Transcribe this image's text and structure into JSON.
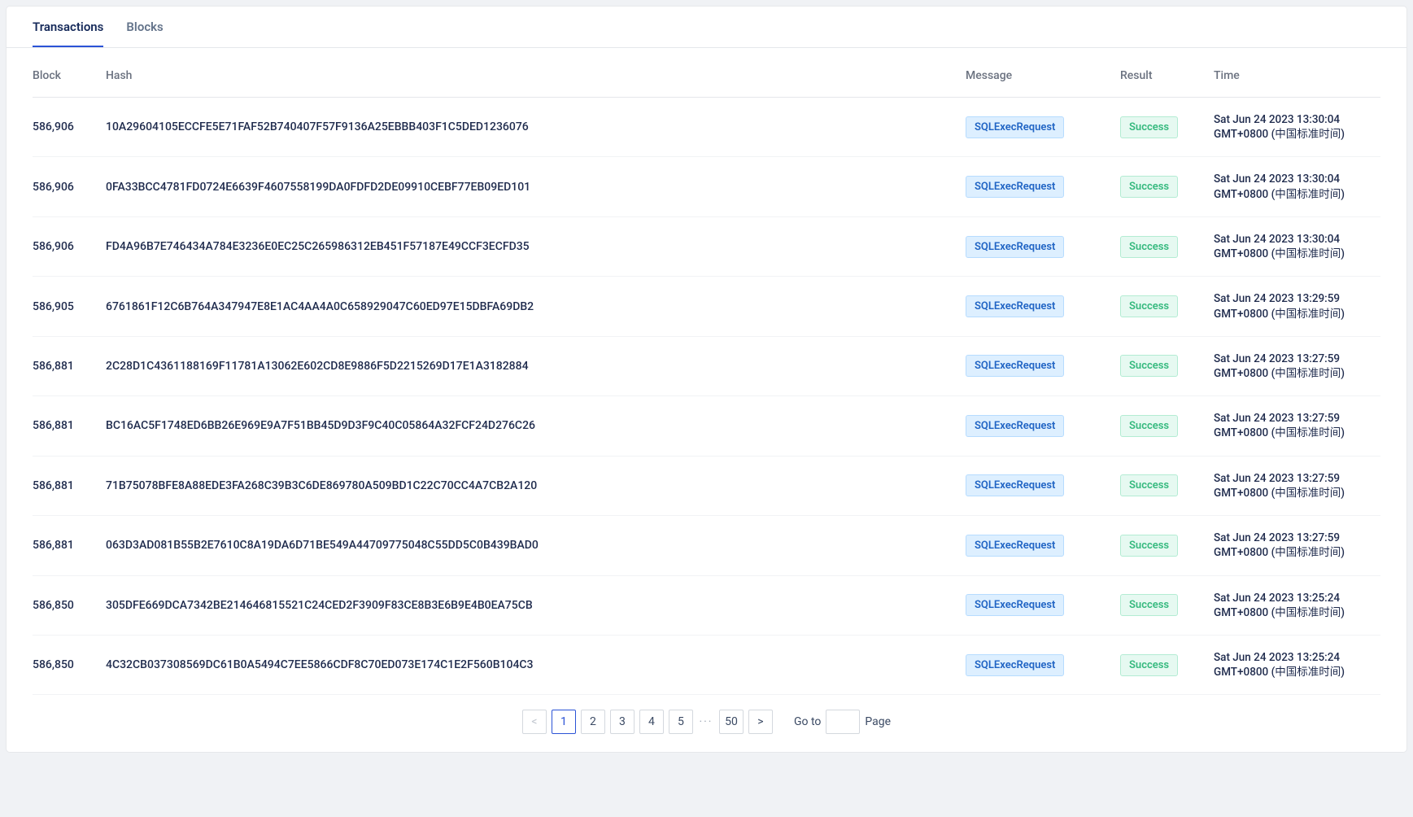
{
  "tabs": {
    "transactions": "Transactions",
    "blocks": "Blocks"
  },
  "headers": {
    "block": "Block",
    "hash": "Hash",
    "message": "Message",
    "result": "Result",
    "time": "Time"
  },
  "rows": [
    {
      "block": "586,906",
      "hash": "10A29604105ECCFE5E71FAF52B740407F57F9136A25EBBB403F1C5DED1236076",
      "message": "SQLExecRequest",
      "result": "Success",
      "time1": "Sat Jun 24 2023 13:30:04",
      "time2": "GMT+0800 (中国标准时间)"
    },
    {
      "block": "586,906",
      "hash": "0FA33BCC4781FD0724E6639F4607558199DA0FDFD2DE09910CEBF77EB09ED101",
      "message": "SQLExecRequest",
      "result": "Success",
      "time1": "Sat Jun 24 2023 13:30:04",
      "time2": "GMT+0800 (中国标准时间)"
    },
    {
      "block": "586,906",
      "hash": "FD4A96B7E746434A784E3236E0EC25C265986312EB451F57187E49CCF3ECFD35",
      "message": "SQLExecRequest",
      "result": "Success",
      "time1": "Sat Jun 24 2023 13:30:04",
      "time2": "GMT+0800 (中国标准时间)"
    },
    {
      "block": "586,905",
      "hash": "6761861F12C6B764A347947E8E1AC4AA4A0C658929047C60ED97E15DBFA69DB2",
      "message": "SQLExecRequest",
      "result": "Success",
      "time1": "Sat Jun 24 2023 13:29:59",
      "time2": "GMT+0800 (中国标准时间)"
    },
    {
      "block": "586,881",
      "hash": "2C28D1C4361188169F11781A13062E602CD8E9886F5D2215269D17E1A3182884",
      "message": "SQLExecRequest",
      "result": "Success",
      "time1": "Sat Jun 24 2023 13:27:59",
      "time2": "GMT+0800 (中国标准时间)"
    },
    {
      "block": "586,881",
      "hash": "BC16AC5F1748ED6BB26E969E9A7F51BB45D9D3F9C40C05864A32FCF24D276C26",
      "message": "SQLExecRequest",
      "result": "Success",
      "time1": "Sat Jun 24 2023 13:27:59",
      "time2": "GMT+0800 (中国标准时间)"
    },
    {
      "block": "586,881",
      "hash": "71B75078BFE8A88EDE3FA268C39B3C6DE869780A509BD1C22C70CC4A7CB2A120",
      "message": "SQLExecRequest",
      "result": "Success",
      "time1": "Sat Jun 24 2023 13:27:59",
      "time2": "GMT+0800 (中国标准时间)"
    },
    {
      "block": "586,881",
      "hash": "063D3AD081B55B2E7610C8A19DA6D71BE549A44709775048C55DD5C0B439BAD0",
      "message": "SQLExecRequest",
      "result": "Success",
      "time1": "Sat Jun 24 2023 13:27:59",
      "time2": "GMT+0800 (中国标准时间)"
    },
    {
      "block": "586,850",
      "hash": "305DFE669DCA7342BE214646815521C24CED2F3909F83CE8B3E6B9E4B0EA75CB",
      "message": "SQLExecRequest",
      "result": "Success",
      "time1": "Sat Jun 24 2023 13:25:24",
      "time2": "GMT+0800 (中国标准时间)"
    },
    {
      "block": "586,850",
      "hash": "4C32CB037308569DC61B0A5494C7EE5866CDF8C70ED073E174C1E2F560B104C3",
      "message": "SQLExecRequest",
      "result": "Success",
      "time1": "Sat Jun 24 2023 13:25:24",
      "time2": "GMT+0800 (中国标准时间)"
    }
  ],
  "pagination": {
    "pages": [
      "1",
      "2",
      "3",
      "4",
      "5"
    ],
    "ellipsis": "···",
    "last": "50",
    "goto_label_pre": "Go to",
    "goto_label_post": "Page",
    "goto_value": "",
    "prev": "<",
    "next": ">"
  }
}
